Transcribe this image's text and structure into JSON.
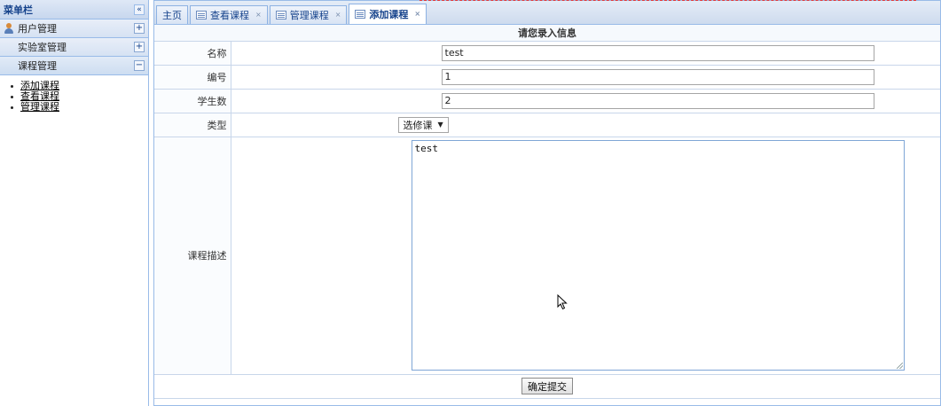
{
  "sidebar": {
    "title": "菜单栏",
    "collapse_icon": "«",
    "sections": [
      {
        "label": "用户管理",
        "icon": "user-icon",
        "toggle": "+"
      },
      {
        "label": "实验室管理",
        "toggle": "+"
      },
      {
        "label": "课程管理",
        "toggle": "−"
      }
    ],
    "submenu": [
      {
        "label": "添加课程"
      },
      {
        "label": "查看课程"
      },
      {
        "label": "管理课程"
      }
    ]
  },
  "tabs": [
    {
      "label": "主页",
      "closable": false
    },
    {
      "label": "查看课程",
      "closable": true
    },
    {
      "label": "管理课程",
      "closable": true
    },
    {
      "label": "添加课程",
      "closable": true,
      "active": true
    }
  ],
  "tab_close_glyph": "×",
  "form": {
    "heading": "请您录入信息",
    "name_label": "名称",
    "name_value": "test",
    "code_label": "编号",
    "code_value": "1",
    "students_label": "学生数",
    "students_value": "2",
    "type_label": "类型",
    "type_value": "选修课",
    "type_arrow": "▼",
    "desc_label": "课程描述",
    "desc_value": "test",
    "submit_label": "确定提交"
  }
}
